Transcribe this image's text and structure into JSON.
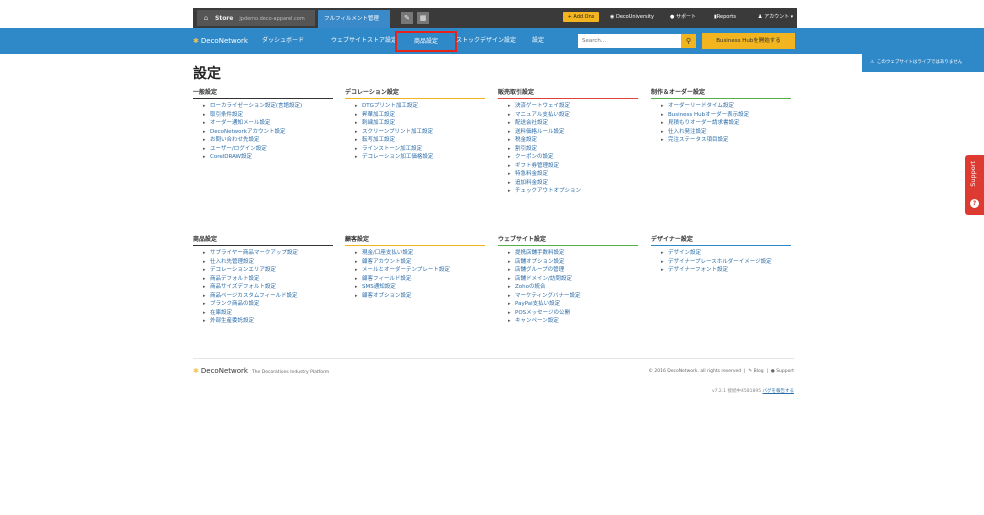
{
  "topbar": {
    "store_label": "Store",
    "store_domain": "jpdemo.deco-apparel.com",
    "fulfillment_label": "フルフィルメント管理",
    "addons_label": "+ Add Ons",
    "university_label": "DecoUniversity",
    "support_label": "サポート",
    "reports_label": "Reports",
    "account_label": "アカウント ▾"
  },
  "nav": {
    "logo": "DecoNetwork",
    "dashboard": "ダッシュボード",
    "website": "ウェブサイトストア設定",
    "products": "商品設定",
    "stock_design": "ストックデザイン設定",
    "settings": "設定",
    "search_placeholder": "Search...",
    "business_hub": "Business Hubを開始する"
  },
  "notice": "このウェブサイトはライブではありません",
  "support_tab": "Support",
  "page_title": "設定",
  "sections": [
    {
      "title": "一般設定",
      "items": [
        "ローカライゼーション設定(言語設定)",
        "取引条件設定",
        "オーダー通知メール設定",
        "DecoNetworkアカウント設定",
        "お問い合わせ先設定",
        "ユーザー/ログイン設定",
        "CorelDRAW設定"
      ]
    },
    {
      "title": "デコレーション設定",
      "items": [
        "DTGプリント加工設定",
        "昇華加工設定",
        "刺繍加工設定",
        "スクリーンプリント加工設定",
        "転写加工設定",
        "ラインストーン加工設定",
        "デコレーション加工価格設定"
      ]
    },
    {
      "title": "販売取引設定",
      "items": [
        "決済ゲートウェイ設定",
        "マニュアル支払い設定",
        "配送会社設定",
        "送料価格ルール設定",
        "税金設定",
        "割引設定",
        "クーポンの設定",
        "ギフト券管理設定",
        "特急料金設定",
        "追加料金設定",
        "チェックアウトオプション"
      ]
    },
    {
      "title": "制作＆オーダー設定",
      "items": [
        "オーダーリードタイム設定",
        "Business Hubオーダー表示設定",
        "見積もりオーダー請求書設定",
        "仕入れ発注設定",
        "完注ステータス項目設定"
      ]
    },
    {
      "title": "商品設定",
      "items": [
        "サプライヤー商品マークアップ設定",
        "仕入れ先管理設定",
        "デコレーションエリア設定",
        "商品デフォルト設定",
        "商品サイズデフォルト設定",
        "商品ページカスタムフィールド設定",
        "ブランク商品の設定",
        "在庫設定",
        "外部生産委託設定"
      ]
    },
    {
      "title": "顧客設定",
      "items": [
        "現金/口座支払い設定",
        "顧客アカウント設定",
        "メールとオーダーテンプレート設定",
        "顧客フィールド設定",
        "SMS通知設定",
        "顧客オプション設定"
      ]
    },
    {
      "title": "ウェブサイト設定",
      "items": [
        "提携店舗手数料設定",
        "店舗オプション設定",
        "店舗グループの管理",
        "店舗ドメイン/訪問設定",
        "Zohoの統合",
        "マーケティングバナー設定",
        "PayPal支払い設定",
        "POSメッセージの公開",
        "キャンペーン設定"
      ]
    },
    {
      "title": "デザイナー設定",
      "items": [
        "デザイン設定",
        "デザイナープレースホルダーイメージ設定",
        "デザイナーフォント設定"
      ]
    }
  ],
  "footer": {
    "logo": "DecoNetwork",
    "tagline": "The Decorations Industry Platform",
    "copyright": "© 2016 DecoNetwork. all rights reserved",
    "blog": "Blog",
    "support": "Support",
    "version": "v7.2.1 接続中4581895",
    "version_link": "バグを報告する"
  },
  "colors": {
    "nav_blue": "#2f88c7",
    "accent_yellow": "#f2b520",
    "highlight_red": "#e5231b"
  }
}
